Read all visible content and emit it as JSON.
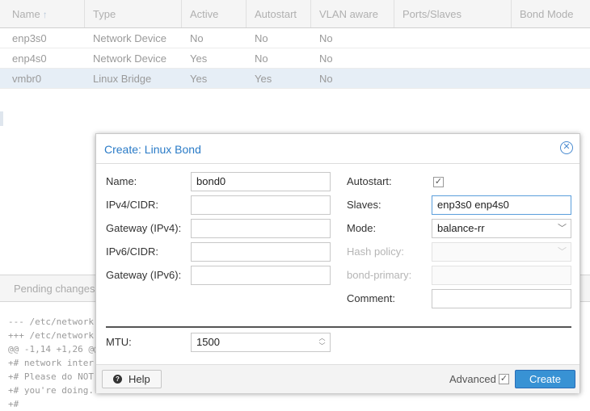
{
  "grid": {
    "columns": [
      "Name",
      "Type",
      "Active",
      "Autostart",
      "VLAN aware",
      "Ports/Slaves",
      "Bond Mode"
    ],
    "rows": [
      {
        "name": "enp3s0",
        "type": "Network Device",
        "active": "No",
        "autostart": "No",
        "vlan": "No"
      },
      {
        "name": "enp4s0",
        "type": "Network Device",
        "active": "Yes",
        "autostart": "No",
        "vlan": "No"
      },
      {
        "name": "vmbr0",
        "type": "Linux Bridge",
        "active": "Yes",
        "autostart": "Yes",
        "vlan": "No"
      }
    ]
  },
  "pending": {
    "title": "Pending changes",
    "diff_lines": [
      "--- /etc/network",
      "+++ /etc/network",
      "@@ -1,14 +1,26 @@",
      "+# network inter",
      "+# Please do NOT",
      "+# you're doing.",
      "+#"
    ]
  },
  "dialog": {
    "title": "Create: Linux Bond",
    "close_icon": "✕",
    "name_label": "Name:",
    "name_value": "bond0",
    "ipv4_label": "IPv4/CIDR:",
    "ipv4_value": "",
    "gw4_label": "Gateway (IPv4):",
    "gw4_value": "",
    "ipv6_label": "IPv6/CIDR:",
    "ipv6_value": "",
    "gw6_label": "Gateway (IPv6):",
    "gw6_value": "",
    "autostart_label": "Autostart:",
    "autostart_checked": true,
    "slaves_label": "Slaves:",
    "slaves_value": "enp3s0 enp4s0",
    "mode_label": "Mode:",
    "mode_value": "balance-rr",
    "hash_label": "Hash policy:",
    "hash_value": "",
    "bond_primary_label": "bond-primary:",
    "bond_primary_value": "",
    "comment_label": "Comment:",
    "comment_value": "",
    "mtu_label": "MTU:",
    "mtu_value": "1500",
    "help_label": "Help",
    "advanced_label": "Advanced",
    "advanced_checked": true,
    "create_label": "Create"
  },
  "colors": {
    "accent": "#3892d4",
    "title": "#2a7bc7",
    "selected_row": "#e6eef6"
  }
}
